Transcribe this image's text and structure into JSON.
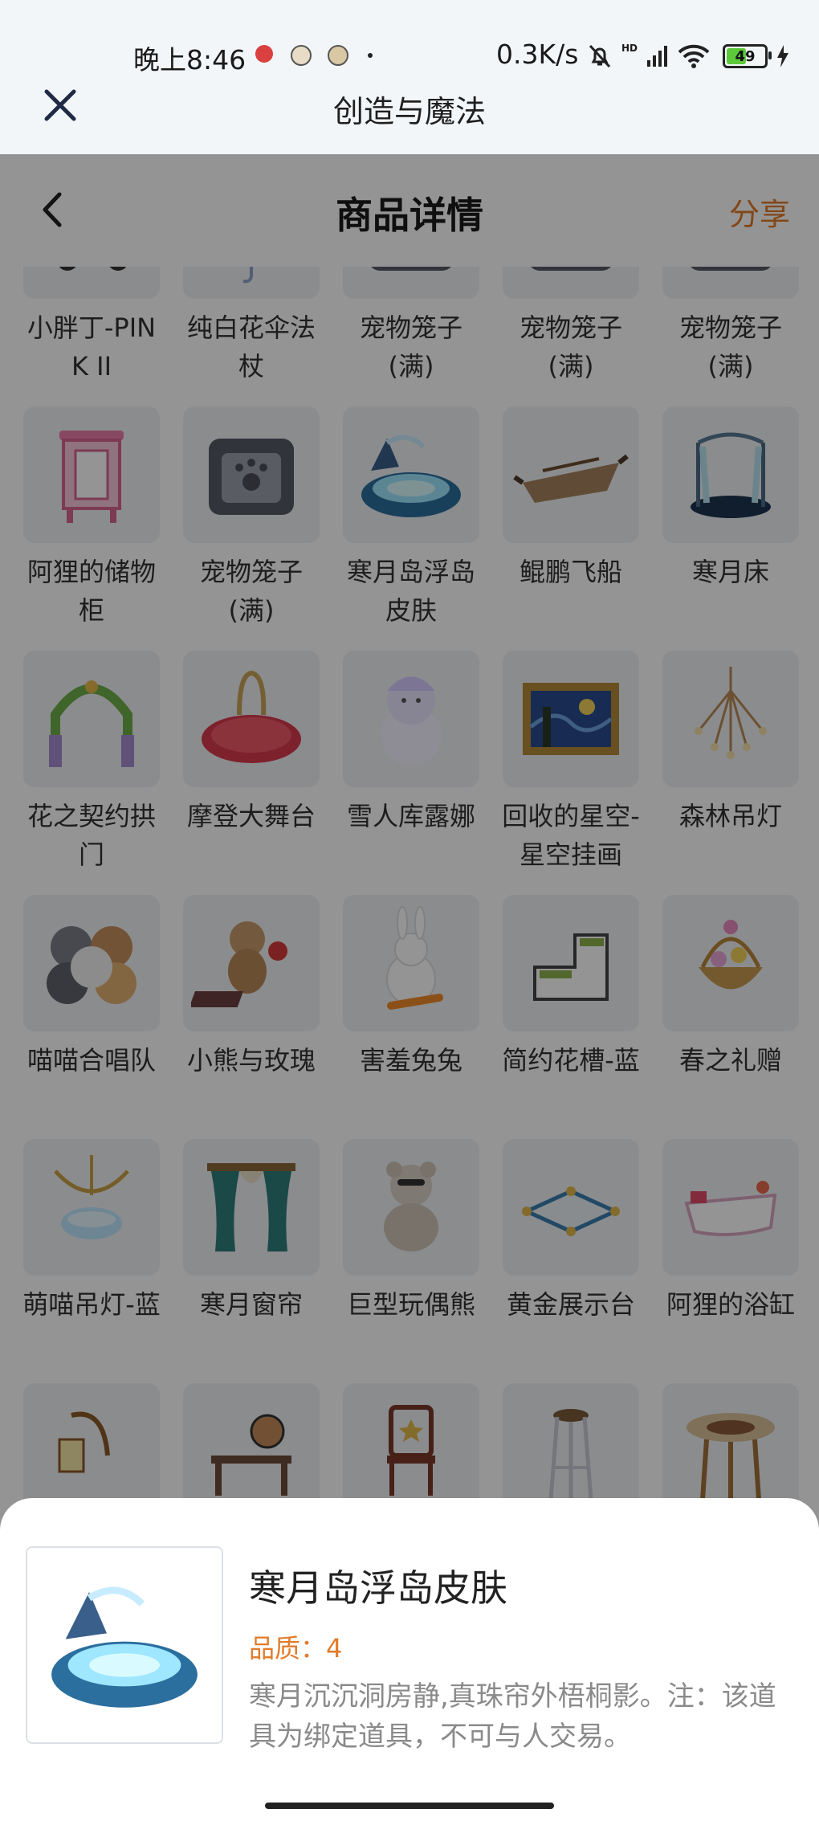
{
  "status_bar": {
    "time": "晚上8:46",
    "net_speed": "0.3K/s",
    "network_badge": "HD",
    "battery": "49",
    "icons": [
      "notification-icon",
      "notification-icon",
      "notification-icon",
      "mute-bell-icon",
      "signal-icon",
      "wifi-icon",
      "battery-icon",
      "charging-icon"
    ]
  },
  "app_header": {
    "title": "创造与魔法",
    "close_icon": "close-icon"
  },
  "nav": {
    "title": "商品详情",
    "share": "分享",
    "back_icon": "back-icon"
  },
  "items": [
    {
      "name": "小胖丁-PINK II",
      "icon": "car"
    },
    {
      "name": "纯白花伞法杖",
      "icon": "umbrella"
    },
    {
      "name": "宠物笼子(满)",
      "icon": "cage"
    },
    {
      "name": "宠物笼子(满)",
      "icon": "cage"
    },
    {
      "name": "宠物笼子(满)",
      "icon": "cage"
    },
    {
      "name": "阿狸的储物柜",
      "icon": "cabinet"
    },
    {
      "name": "宠物笼子(满)",
      "icon": "cage"
    },
    {
      "name": "寒月岛浮岛皮肤",
      "icon": "island"
    },
    {
      "name": "鲲鹏飞船",
      "icon": "ship"
    },
    {
      "name": "寒月床",
      "icon": "bed"
    },
    {
      "name": "花之契约拱门",
      "icon": "arch"
    },
    {
      "name": "摩登大舞台",
      "icon": "stage"
    },
    {
      "name": "雪人库露娜",
      "icon": "snowman"
    },
    {
      "name": "回收的星空-星空挂画",
      "icon": "painting"
    },
    {
      "name": "森林吊灯",
      "icon": "chandelier"
    },
    {
      "name": "喵喵合唱队",
      "icon": "cats"
    },
    {
      "name": "小熊与玫瑰",
      "icon": "bear-rose"
    },
    {
      "name": "害羞兔兔",
      "icon": "rabbit"
    },
    {
      "name": "简约花槽-蓝",
      "icon": "planter"
    },
    {
      "name": "春之礼赠",
      "icon": "basket"
    },
    {
      "name": "萌喵吊灯-蓝",
      "icon": "lamp"
    },
    {
      "name": "寒月窗帘",
      "icon": "curtain"
    },
    {
      "name": "巨型玩偶熊",
      "icon": "teddy"
    },
    {
      "name": "黄金展示台",
      "icon": "platform"
    },
    {
      "name": "阿狸的浴缸",
      "icon": "bathtub"
    },
    {
      "name": "",
      "icon": "lantern"
    },
    {
      "name": "",
      "icon": "desk"
    },
    {
      "name": "",
      "icon": "chair"
    },
    {
      "name": "",
      "icon": "stool"
    },
    {
      "name": "",
      "icon": "table"
    }
  ],
  "selected_item": {
    "name": "寒月岛浮岛皮肤",
    "quality": "品质：4",
    "description": "寒月沉沉洞房静,真珠帘外梧桐影。注：该道具为绑定道具，不可与人交易。",
    "icon": "island"
  },
  "colors": {
    "accent": "#e27b2a",
    "overlay": "rgba(0,0,0,0.42)"
  }
}
